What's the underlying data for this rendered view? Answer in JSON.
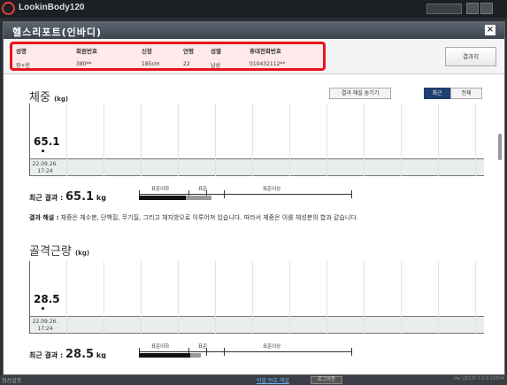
{
  "app": {
    "title": "LookinBody120"
  },
  "dialog": {
    "title": "헬스리포트(인바디)",
    "close_label": "×"
  },
  "info": {
    "columns": [
      {
        "label": "성명",
        "value": "장+윤"
      },
      {
        "label": "회원번호",
        "value": "380**"
      },
      {
        "label": "신장",
        "value": "185cm"
      },
      {
        "label": "연령",
        "value": "22"
      },
      {
        "label": "성별",
        "value": "남성"
      },
      {
        "label": "휴대전화번호",
        "value": "010432112**"
      }
    ],
    "result_button": "결과지"
  },
  "controls": {
    "hide_explanation": "결과 해설 숨기기",
    "recent": "최근",
    "all": "전체"
  },
  "sections": [
    {
      "title": "체중",
      "unit": "(kg)",
      "graph_value": "65.1",
      "graph_date": [
        "22.09.26.",
        "17:24"
      ],
      "result_label": "최근 결과 :",
      "result_value": "65.1",
      "result_unit": "kg",
      "scale_labels": [
        "표준이하",
        "표준",
        "표준이상"
      ],
      "bar_black_fraction": 0.22,
      "bar_gray_fraction": 0.12,
      "interp_label": "결과 해설 :",
      "interp_text": "체중은 체수분, 단백질, 무기질, 그리고 체지방으로 이루어져 있습니다. 따라서 체중은 이를 체성분의 합과 같습니다."
    },
    {
      "title": "골격근량",
      "unit": "(kg)",
      "graph_value": "28.5",
      "graph_date": [
        "22.09.26.",
        "17:24"
      ],
      "result_label": "최근 결과 :",
      "result_value": "28.5",
      "result_unit": "kg",
      "scale_labels": [
        "표준이하",
        "표준",
        "표준이상"
      ],
      "bar_black_fraction": 0.24,
      "bar_gray_fraction": 0.05
    }
  ],
  "status": {
    "left": "정산설정",
    "link": "비밀 번호 해설",
    "button": "로그아웃",
    "right": "Ver LB120 3.0.0.10504"
  },
  "colors": {
    "highlight_border": "#e8141a",
    "highlight_fill": "#ffe9ea",
    "active_button": "#1f3f6e"
  }
}
